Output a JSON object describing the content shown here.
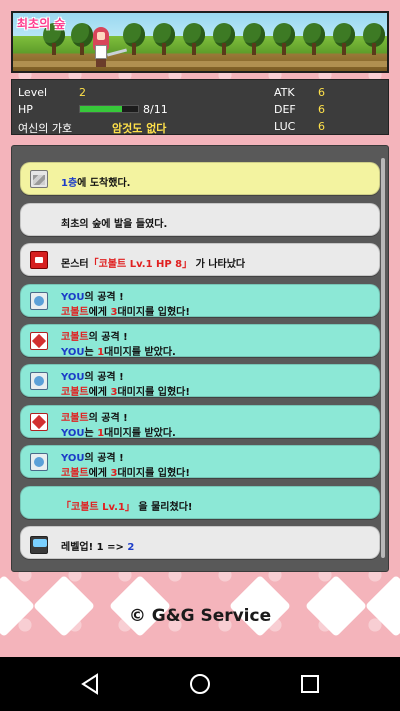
{
  "scene": {
    "title": "최초의 숲"
  },
  "stats": {
    "level_label": "Level",
    "level_value": "2",
    "hp_label": "HP",
    "hp_value": "8/11",
    "hp_fraction": 0.727,
    "blessing_label": "여신의 가호",
    "blessing_value": "암것도 없다",
    "atk_label": "ATK",
    "atk_value": "6",
    "def_label": "DEF",
    "def_value": "6",
    "luc_label": "LUC",
    "luc_value": "6"
  },
  "log": {
    "messages": [
      {
        "style": "yellow",
        "icon": "stairs-icon",
        "parts": [
          "1층",
          "에 도착했다."
        ]
      },
      {
        "style": "white",
        "icon": null,
        "parts": [
          "최초의 숲에 발을 들였다."
        ]
      },
      {
        "style": "white",
        "icon": "monster-icon",
        "parts": [
          "몬스터",
          "「코볼트 Lv.1 HP 8」",
          "가 나타났다"
        ]
      },
      {
        "style": "teal",
        "icon": "hero-attack-icon",
        "lines": [
          [
            "YOU",
            "의 공격 !"
          ],
          [
            "코볼트",
            "에게 ",
            "3",
            "대미지를 입혔다!"
          ]
        ]
      },
      {
        "style": "teal",
        "icon": "enemy-attack-icon",
        "lines": [
          [
            "코볼트",
            "의 공격 !"
          ],
          [
            "YOU",
            "는 ",
            "1",
            "대미지를 받았다."
          ]
        ]
      },
      {
        "style": "teal",
        "icon": "hero-attack-icon",
        "lines": [
          [
            "YOU",
            "의 공격 !"
          ],
          [
            "코볼트",
            "에게 ",
            "3",
            "대미지를 입혔다!"
          ]
        ]
      },
      {
        "style": "teal",
        "icon": "enemy-attack-icon",
        "lines": [
          [
            "코볼트",
            "의 공격 !"
          ],
          [
            "YOU",
            "는 ",
            "1",
            "대미지를 받았다."
          ]
        ]
      },
      {
        "style": "teal",
        "icon": "hero-attack-icon",
        "lines": [
          [
            "YOU",
            "의 공격 !"
          ],
          [
            "코볼트",
            "에게 ",
            "3",
            "대미지를 입혔다!"
          ]
        ]
      },
      {
        "style": "teal",
        "icon": null,
        "parts": [
          "「코볼트 Lv.1」",
          "을 물리쳤다!"
        ]
      },
      {
        "style": "white",
        "icon": "level-up-icon",
        "parts": [
          "레벨업! 1 => ",
          "2"
        ]
      }
    ]
  },
  "footer": {
    "copyright": "© G&G Service"
  },
  "colors": {
    "background": "#f4b4bb",
    "panel": "#595959",
    "yellow_msg": "#f3f3a0",
    "teal_msg": "#8ce8d6",
    "white_msg": "#eaeaea",
    "blue_text": "#1c3cc8",
    "red_text": "#e02020",
    "stat_value": "#ffe14a",
    "hp_bar": "#37c83a"
  },
  "nav": {
    "back_icon": "back-triangle-icon",
    "home_icon": "home-circle-icon",
    "recent_icon": "recent-square-icon"
  }
}
